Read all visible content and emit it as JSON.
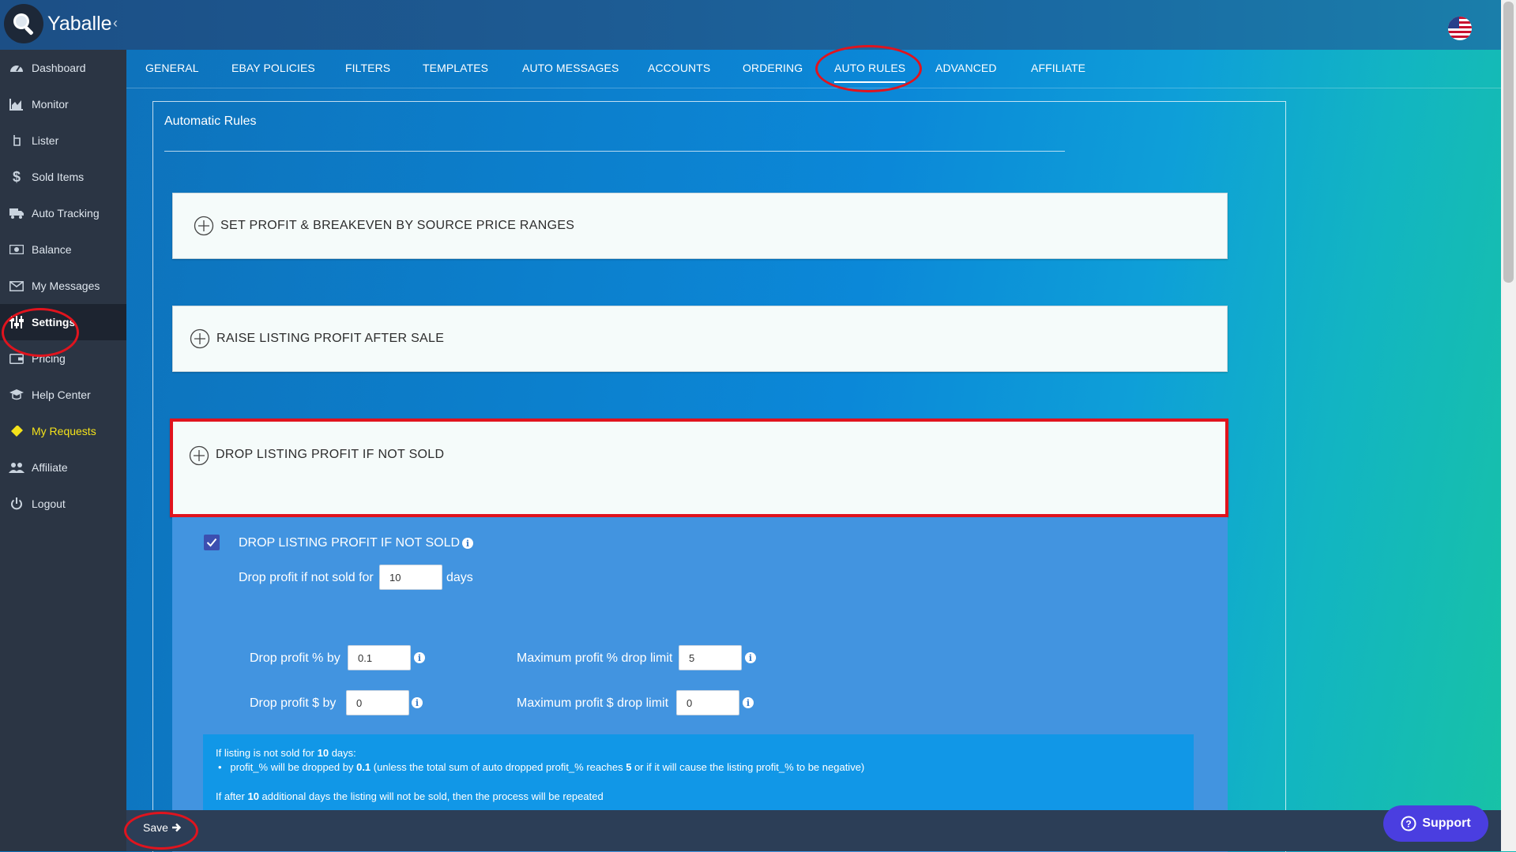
{
  "app": {
    "brand": "Yaballe"
  },
  "sidebar": {
    "items": [
      {
        "label": "Dashboard",
        "icon": "gauge-icon"
      },
      {
        "label": "Monitor",
        "icon": "area-chart-icon"
      },
      {
        "label": "Lister",
        "icon": "hand-pointer-icon"
      },
      {
        "label": "Sold Items",
        "icon": "dollar-icon"
      },
      {
        "label": "Auto Tracking",
        "icon": "truck-icon"
      },
      {
        "label": "Balance",
        "icon": "money-icon"
      },
      {
        "label": "My Messages",
        "icon": "envelope-icon"
      },
      {
        "label": "Settings",
        "icon": "sliders-icon",
        "active": true
      },
      {
        "label": "Pricing",
        "icon": "wallet-icon"
      },
      {
        "label": "Help Center",
        "icon": "graduation-cap-icon"
      },
      {
        "label": "My Requests",
        "icon": "ticket-icon",
        "highlight": true
      },
      {
        "label": "Affiliate",
        "icon": "users-icon"
      },
      {
        "label": "Logout",
        "icon": "power-icon"
      }
    ]
  },
  "tabs": [
    {
      "label": "GENERAL"
    },
    {
      "label": "EBAY POLICIES"
    },
    {
      "label": "FILTERS"
    },
    {
      "label": "TEMPLATES"
    },
    {
      "label": "AUTO MESSAGES"
    },
    {
      "label": "ACCOUNTS"
    },
    {
      "label": "ORDERING"
    },
    {
      "label": "AUTO RULES",
      "active": true
    },
    {
      "label": "ADVANCED"
    },
    {
      "label": "AFFILIATE"
    }
  ],
  "panel": {
    "title": "Automatic Rules",
    "accordions": [
      {
        "label": "SET PROFIT & BREAKEVEN BY SOURCE PRICE RANGES"
      },
      {
        "label": "RAISE LISTING PROFIT AFTER SALE"
      },
      {
        "label": "DROP LISTING PROFIT IF NOT SOLD",
        "expanded": true
      }
    ]
  },
  "drop_rule": {
    "enabled_label": "DROP LISTING PROFIT IF NOT SOLD",
    "enabled": true,
    "days_prefix": "Drop profit if not sold for",
    "days_value": "10",
    "days_suffix": "days",
    "drop_pct_label": "Drop profit % by",
    "drop_pct_value": "0.1",
    "drop_usd_label": "Drop profit $ by",
    "drop_usd_value": "0",
    "max_pct_label": "Maximum profit % drop limit",
    "max_pct_value": "5",
    "max_usd_label": "Maximum profit $ drop limit",
    "max_usd_value": "0"
  },
  "summary": {
    "line1_prefix": "If listing is not sold for ",
    "line1_days": "10",
    "line1_suffix": " days:",
    "bullet_prefix": "profit_% will be dropped by ",
    "bullet_value": "0.1",
    "bullet_mid": " (unless the total sum of auto dropped profit_% reaches ",
    "bullet_limit": "5",
    "bullet_suffix": " or if it will cause the listing profit_% to be negative)",
    "line3_prefix": "If after ",
    "line3_days": "10",
    "line3_suffix": " additional days the listing will not be sold, then the process will be repeated"
  },
  "footer": {
    "save_label": "Save",
    "support_label": "Support"
  },
  "colors": {
    "annotation": "#e0141e",
    "support": "#4a3ee0",
    "sidebar": "#2b3544"
  }
}
